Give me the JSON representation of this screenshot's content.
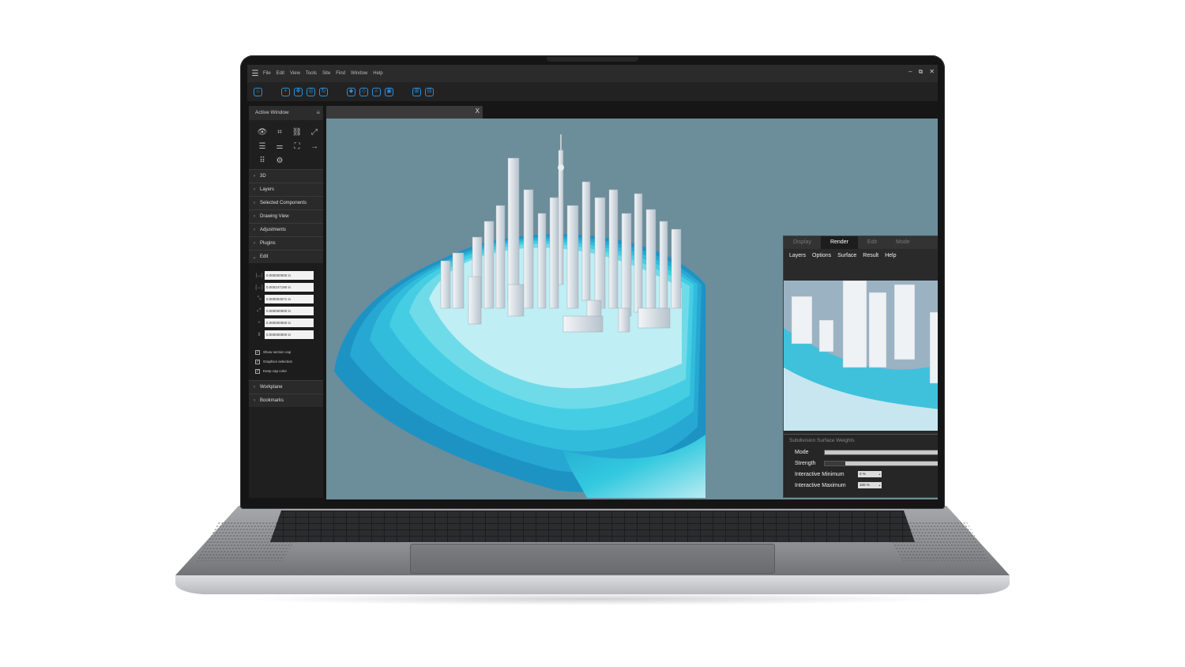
{
  "menubar": {
    "items": [
      "File",
      "Edit",
      "View",
      "Tools",
      "Site",
      "Find",
      "Window",
      "Help"
    ],
    "window_controls": [
      "–",
      "⧉",
      "✕"
    ]
  },
  "toolbar": {
    "icons": [
      "home-icon",
      "zoom-extents-icon",
      "pan-icon",
      "orbit-icon",
      "rotate-icon",
      "walk-icon",
      "fly-icon",
      "zoom-icon",
      "zoom-window-icon",
      "measure-icon",
      "section-icon"
    ]
  },
  "left_panel": {
    "title": "Active Window",
    "sections_top": [
      "3D",
      "Layers",
      "Selected Components",
      "Drawing View",
      "Adjustments",
      "Plugins"
    ],
    "edit_section": "Edit",
    "fields": [
      "0.000000000 in",
      "0.000247190 in",
      "0.000004571 in",
      "0.000000000 in",
      "0.000000000 in",
      "0.000000000 in"
    ],
    "checkboxes": [
      "Show section cap",
      "Graphics selection",
      "Keep cap color"
    ],
    "sections_bottom": [
      "Workplane",
      "Bookmarks"
    ]
  },
  "document_tab": {
    "close": "X"
  },
  "render_panel": {
    "tabs": [
      "Display",
      "Render",
      "Edit",
      "Mode"
    ],
    "active_tab": "Render",
    "menu": [
      "Layers",
      "Options",
      "Surface",
      "Result",
      "Help"
    ],
    "props_title": "Subdivision Surface Weights",
    "mode_label": "Mode",
    "strength_label": "Strength",
    "strength_value": 0.12,
    "interactive_min_label": "Interactive Minimum",
    "interactive_min_value": "0 %",
    "interactive_max_label": "Interactive Maximum",
    "interactive_max_value": "100 %"
  },
  "colors": {
    "accent": "#2d8fd6",
    "viewport_bg": "#6c8d9a",
    "water": "#2ec3dc"
  }
}
